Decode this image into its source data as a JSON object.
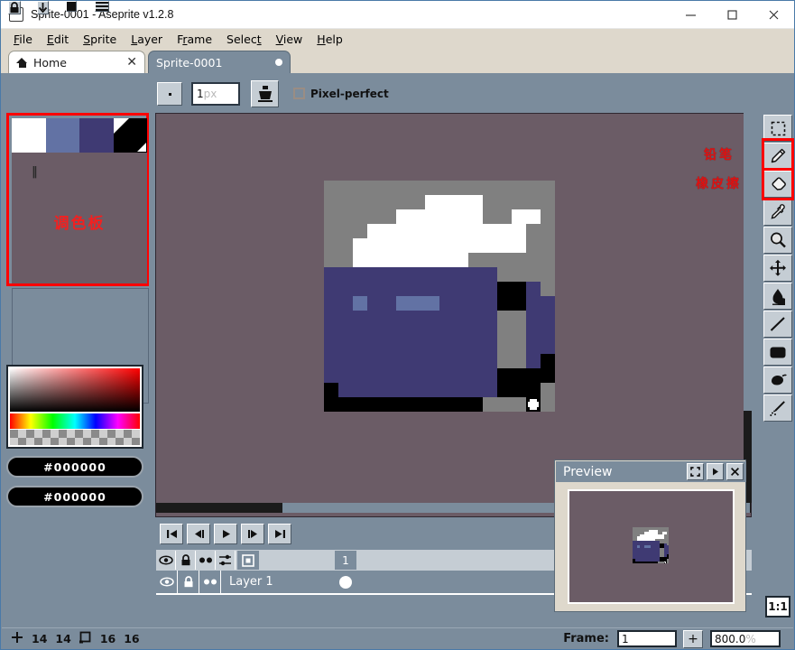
{
  "window": {
    "title": "Sprite-0001 - Aseprite v1.2.8",
    "icon": "aseprite-icon",
    "minimize": "—",
    "maximize": "□",
    "close": "✕"
  },
  "menubar": {
    "items": [
      {
        "label": "File",
        "accel": "F"
      },
      {
        "label": "Edit",
        "accel": "E"
      },
      {
        "label": "Sprite",
        "accel": "S"
      },
      {
        "label": "Layer",
        "accel": "L"
      },
      {
        "label": "Frame",
        "accel": "r"
      },
      {
        "label": "Select",
        "accel": "t"
      },
      {
        "label": "View",
        "accel": "V"
      },
      {
        "label": "Help",
        "accel": "H"
      }
    ]
  },
  "tabs": [
    {
      "label": "Home",
      "icon": "home-icon",
      "close": "✕",
      "active": false
    },
    {
      "label": "Sprite-0001",
      "modified_dot": true,
      "active": true
    }
  ],
  "context_toolbar": {
    "buttons": [
      {
        "name": "lock-alpha-button",
        "icon": "lock-icon"
      },
      {
        "name": "download-button",
        "icon": "arrow-down-icon"
      },
      {
        "name": "filled-square-button",
        "icon": "square-icon"
      },
      {
        "name": "menu-button",
        "icon": "hamburger-icon"
      }
    ],
    "brush_size": {
      "value": "1",
      "unit": "px"
    },
    "ink_icon": "ink-bucket-icon",
    "pixel_perfect_label": "Pixel-perfect",
    "pixel_perfect_checked": false
  },
  "palette": {
    "annotation": "调色板",
    "pause_glyph": "‖",
    "swatches": [
      "#ffffff",
      "#6272a4",
      "#3f3a73",
      "#000000"
    ],
    "highlight_color": "#ff0000"
  },
  "color_picker": {
    "foreground_hex": "#000000",
    "background_hex": "#000000"
  },
  "canvas": {
    "background": "#6b5c66",
    "sprite_width": 16,
    "sprite_height": 16,
    "pixels": [
      "GGGGGGGGGGGGGGGG",
      "GGGGGGGWWWWGGGGG",
      "GGGGGWWWWWWGGWWG",
      "GGGWWWWWWWWWWWGG",
      "GGWWWWWWWWWWWWGG",
      "GGWWWWWWWWGGGGGG",
      "PPPPPPPPPPPPGGGG",
      "PPPPPPPPPPPPKKPG",
      "PPLPPLLLPPPPKKPP",
      "PPPPPPPPPPPPGGPP",
      "PPPPPPPPPPPPGGPP",
      "PPPPPPPPPPPPGGPP",
      "PPPPPPPPPPPPGGPK",
      "PPPPPPPPPPPPKKKK",
      "KPPPPPPPPPPPKKKG",
      "KKKKKKKKKKKGGGXG"
    ],
    "palette_map": {
      "G": "#808080",
      "W": "#ffffff",
      "P": "#3f3a73",
      "L": "#6272a4",
      "K": "#000000",
      "X": "cursor-cross"
    }
  },
  "playback": {
    "buttons": [
      {
        "name": "go-first-frame-button",
        "icon": "skip-back-icon"
      },
      {
        "name": "go-prev-frame-button",
        "icon": "step-back-icon"
      },
      {
        "name": "play-button",
        "icon": "play-icon"
      },
      {
        "name": "go-next-frame-button",
        "icon": "step-forward-icon"
      },
      {
        "name": "go-last-frame-button",
        "icon": "skip-forward-icon"
      }
    ]
  },
  "timeline": {
    "header_icons": [
      {
        "name": "eye-icon"
      },
      {
        "name": "lock-icon"
      },
      {
        "name": "continuous-icon"
      },
      {
        "name": "onion-skin-icon"
      }
    ],
    "new-frame-icon": "new-frame-icon",
    "frame_number": "1",
    "layer": {
      "name": "Layer 1",
      "visible_icon": "eye-icon",
      "lock_icon": "unlock-icon",
      "continuous_icon": "continuous-icon",
      "cel": "filled-dot"
    }
  },
  "tools": [
    {
      "name": "marquee-select-tool",
      "icon": "marquee-icon",
      "selected": false
    },
    {
      "name": "pencil-tool",
      "icon": "pencil-icon",
      "selected": true,
      "annotation": "铅笔"
    },
    {
      "name": "eraser-tool",
      "icon": "eraser-icon",
      "selected": true,
      "annotation": "橡皮擦"
    },
    {
      "name": "eyedropper-tool",
      "icon": "eyedropper-icon",
      "selected": false
    },
    {
      "name": "zoom-tool",
      "icon": "magnifier-icon",
      "selected": false
    },
    {
      "name": "move-tool",
      "icon": "move-arrows-icon",
      "selected": false
    },
    {
      "name": "blur-tool",
      "icon": "blur-drop-icon",
      "selected": false
    },
    {
      "name": "line-tool",
      "icon": "line-icon",
      "selected": false
    },
    {
      "name": "rectangle-tool",
      "icon": "filled-rect-icon",
      "selected": false
    },
    {
      "name": "paint-bucket-tool",
      "icon": "paint-bucket-icon",
      "selected": false
    },
    {
      "name": "spray-tool",
      "icon": "spray-icon",
      "selected": false
    }
  ],
  "zoom_reset": {
    "label": "1:1"
  },
  "preview": {
    "title": "Preview",
    "buttons": [
      {
        "name": "preview-expand-button",
        "icon": "expand-icon"
      },
      {
        "name": "preview-play-button",
        "icon": "play-icon"
      },
      {
        "name": "preview-close-button",
        "icon": "close-icon"
      }
    ]
  },
  "statusbar": {
    "cursor_icon": "crosshair-icon",
    "cursor_x": "14",
    "cursor_y": "14",
    "size_icon": "sprite-size-icon",
    "sprite_w": "16",
    "sprite_h": "16",
    "frame_label": "Frame:",
    "frame_value": "1",
    "add_frame_label": "+",
    "zoom_value": "800.0",
    "zoom_unit": "%"
  }
}
